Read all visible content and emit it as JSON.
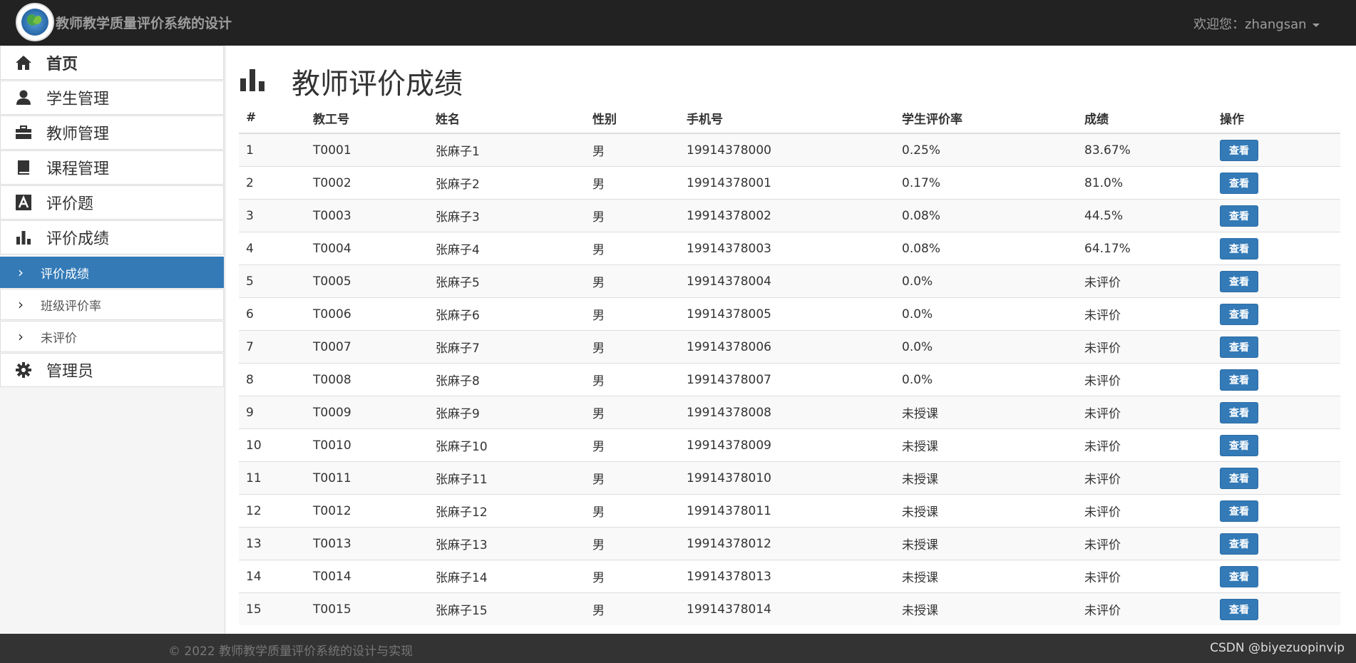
{
  "header": {
    "brand_title": "教师教学质量评价系统的设计",
    "user_menu_label": "欢迎您：zhangsan"
  },
  "sidebar": {
    "items": [
      {
        "label": "首页",
        "icon": "home-icon"
      },
      {
        "label": "学生管理",
        "icon": "user-icon"
      },
      {
        "label": "教师管理",
        "icon": "briefcase-icon"
      },
      {
        "label": "课程管理",
        "icon": "book-icon"
      },
      {
        "label": "评价题",
        "icon": "font-icon"
      },
      {
        "label": "评价成绩",
        "icon": "bar-chart-icon"
      }
    ],
    "sub_items": [
      {
        "label": "评价成绩",
        "active": true
      },
      {
        "label": "班级评价率",
        "active": false
      },
      {
        "label": "未评价",
        "active": false
      }
    ],
    "admin": {
      "label": "管理员",
      "icon": "gear-icon"
    }
  },
  "main": {
    "page_title": "教师评价成绩",
    "table": {
      "columns": [
        "#",
        "教工号",
        "姓名",
        "性别",
        "手机号",
        "学生评价率",
        "成绩",
        "操作"
      ],
      "action_label": "查看",
      "rows": [
        {
          "idx": "1",
          "id": "T0001",
          "name": "张麻子1",
          "gender": "男",
          "phone": "19914378000",
          "rate": "0.25%",
          "score": "83.67%"
        },
        {
          "idx": "2",
          "id": "T0002",
          "name": "张麻子2",
          "gender": "男",
          "phone": "19914378001",
          "rate": "0.17%",
          "score": "81.0%"
        },
        {
          "idx": "3",
          "id": "T0003",
          "name": "张麻子3",
          "gender": "男",
          "phone": "19914378002",
          "rate": "0.08%",
          "score": "44.5%"
        },
        {
          "idx": "4",
          "id": "T0004",
          "name": "张麻子4",
          "gender": "男",
          "phone": "19914378003",
          "rate": "0.08%",
          "score": "64.17%"
        },
        {
          "idx": "5",
          "id": "T0005",
          "name": "张麻子5",
          "gender": "男",
          "phone": "19914378004",
          "rate": "0.0%",
          "score": "未评价"
        },
        {
          "idx": "6",
          "id": "T0006",
          "name": "张麻子6",
          "gender": "男",
          "phone": "19914378005",
          "rate": "0.0%",
          "score": "未评价"
        },
        {
          "idx": "7",
          "id": "T0007",
          "name": "张麻子7",
          "gender": "男",
          "phone": "19914378006",
          "rate": "0.0%",
          "score": "未评价"
        },
        {
          "idx": "8",
          "id": "T0008",
          "name": "张麻子8",
          "gender": "男",
          "phone": "19914378007",
          "rate": "0.0%",
          "score": "未评价"
        },
        {
          "idx": "9",
          "id": "T0009",
          "name": "张麻子9",
          "gender": "男",
          "phone": "19914378008",
          "rate": "未授课",
          "score": "未评价"
        },
        {
          "idx": "10",
          "id": "T0010",
          "name": "张麻子10",
          "gender": "男",
          "phone": "19914378009",
          "rate": "未授课",
          "score": "未评价"
        },
        {
          "idx": "11",
          "id": "T0011",
          "name": "张麻子11",
          "gender": "男",
          "phone": "19914378010",
          "rate": "未授课",
          "score": "未评价"
        },
        {
          "idx": "12",
          "id": "T0012",
          "name": "张麻子12",
          "gender": "男",
          "phone": "19914378011",
          "rate": "未授课",
          "score": "未评价"
        },
        {
          "idx": "13",
          "id": "T0013",
          "name": "张麻子13",
          "gender": "男",
          "phone": "19914378012",
          "rate": "未授课",
          "score": "未评价"
        },
        {
          "idx": "14",
          "id": "T0014",
          "name": "张麻子14",
          "gender": "男",
          "phone": "19914378013",
          "rate": "未授课",
          "score": "未评价"
        },
        {
          "idx": "15",
          "id": "T0015",
          "name": "张麻子15",
          "gender": "男",
          "phone": "19914378014",
          "rate": "未授课",
          "score": "未评价"
        }
      ]
    }
  },
  "footer": {
    "copyright": "© 2022 教师教学质量评价系统的设计与实现",
    "watermark": "CSDN @biyezuopinvip"
  },
  "colors": {
    "navbar": "#222222",
    "active": "#337ab7",
    "footer": "#333333"
  }
}
